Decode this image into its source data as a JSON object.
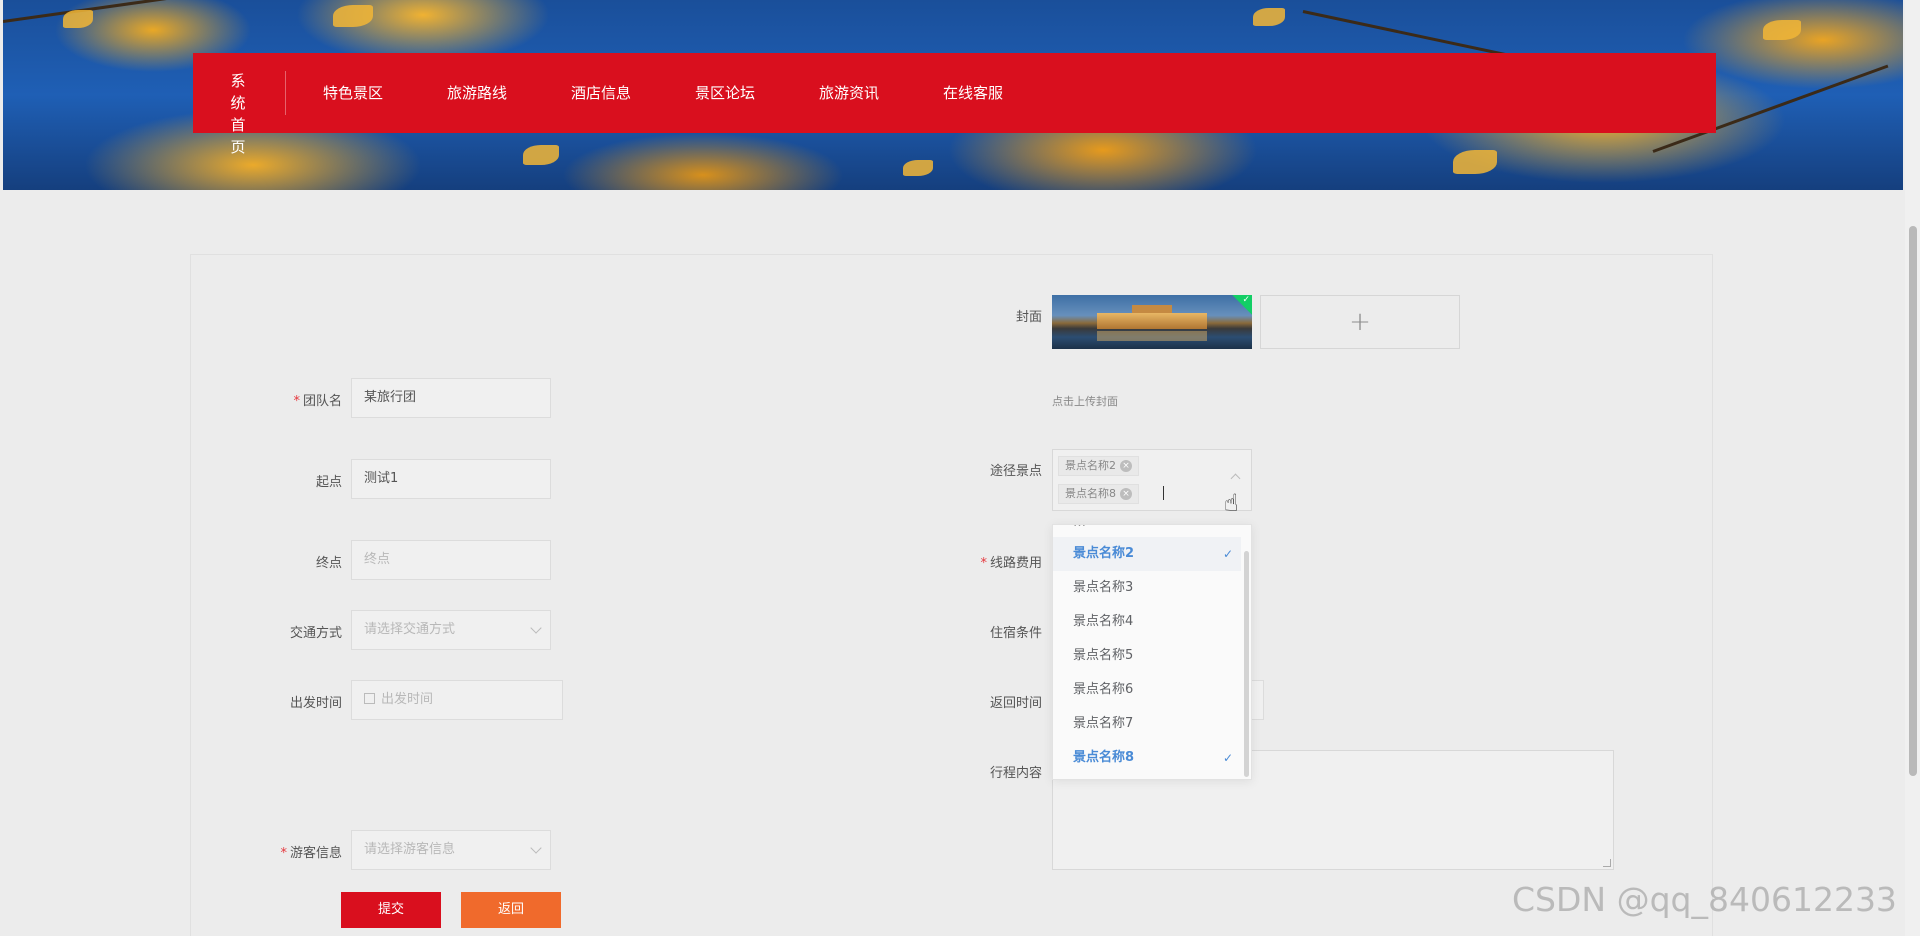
{
  "nav": {
    "home": "系 统 首 页",
    "items": [
      "特色景区",
      "旅游路线",
      "酒店信息",
      "景区论坛",
      "旅游资讯",
      "在线客服"
    ]
  },
  "form": {
    "cover": {
      "label": "封面",
      "hint": "点击上传封面",
      "upload_icon": "+"
    },
    "team": {
      "label": "团队名",
      "value": "某旅行团"
    },
    "start": {
      "label": "起点",
      "value": "测试1"
    },
    "end": {
      "label": "终点",
      "placeholder": "终点"
    },
    "transport": {
      "label": "交通方式",
      "placeholder": "请选择交通方式"
    },
    "depart": {
      "label": "出发时间",
      "placeholder": "出发时间"
    },
    "tourist": {
      "label": "游客信息",
      "placeholder": "请选择游客信息"
    },
    "spots": {
      "label": "途径景点",
      "tags": [
        "景点名称2",
        "景点名称8"
      ],
      "options": [
        {
          "label": "景点名称2",
          "selected": true
        },
        {
          "label": "景点名称3",
          "selected": false
        },
        {
          "label": "景点名称4",
          "selected": false
        },
        {
          "label": "景点名称5",
          "selected": false
        },
        {
          "label": "景点名称6",
          "selected": false
        },
        {
          "label": "景点名称7",
          "selected": false
        },
        {
          "label": "景点名称8",
          "selected": true
        }
      ]
    },
    "fee": {
      "label": "线路费用"
    },
    "lodging": {
      "label": "住宿条件"
    },
    "return": {
      "label": "返回时间"
    },
    "itinerary": {
      "label": "行程内容"
    },
    "buttons": {
      "submit": "提交",
      "back": "返回"
    }
  },
  "watermark": "CSDN @qq_840612233",
  "colors": {
    "primary": "#d90f1e",
    "back_button": "#f06a2c",
    "selected_option": "#4a8bd6",
    "success_badge": "#13ce66"
  }
}
